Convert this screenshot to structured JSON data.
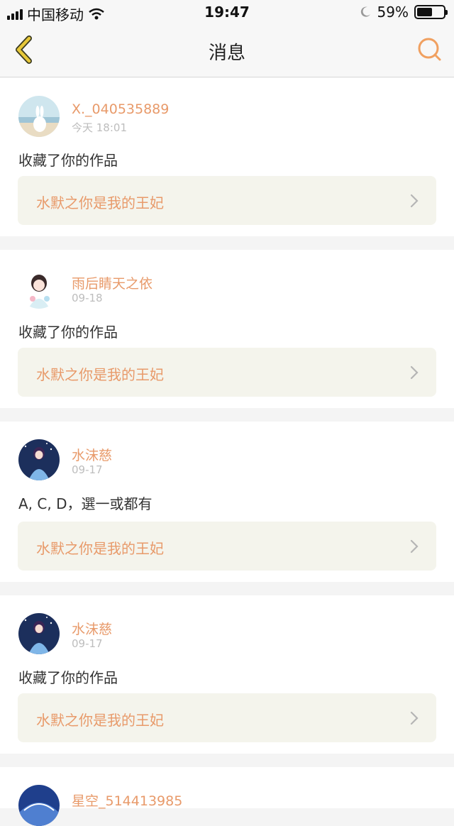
{
  "status_bar": {
    "carrier": "中国移动",
    "time": "19:47",
    "battery_pct": "59%",
    "battery_level": 0.59,
    "icons": [
      "signal-icon",
      "wifi-icon",
      "moon-icon",
      "battery-icon"
    ]
  },
  "nav": {
    "title": "消息",
    "back_icon": "back-chevron-icon",
    "search_icon": "search-icon",
    "accent": "#e89a6a",
    "back_color": "#e7c83a"
  },
  "messages": [
    {
      "user": "X._040535889",
      "time": "今天 18:01",
      "text": "收藏了你的作品",
      "work": "水默之你是我的王妃"
    },
    {
      "user": "雨后睛天之依",
      "time": "09-18",
      "text": "收藏了你的作品",
      "work": "水默之你是我的王妃"
    },
    {
      "user": "水沫慈",
      "time": "09-17",
      "text": "A, C, D，選一或都有",
      "work": "水默之你是我的王妃"
    },
    {
      "user": "水沫慈",
      "time": "09-17",
      "text": "收藏了你的作品",
      "work": "水默之你是我的王妃"
    },
    {
      "user": "星空_514413985",
      "time": "",
      "text": "",
      "work": ""
    }
  ]
}
